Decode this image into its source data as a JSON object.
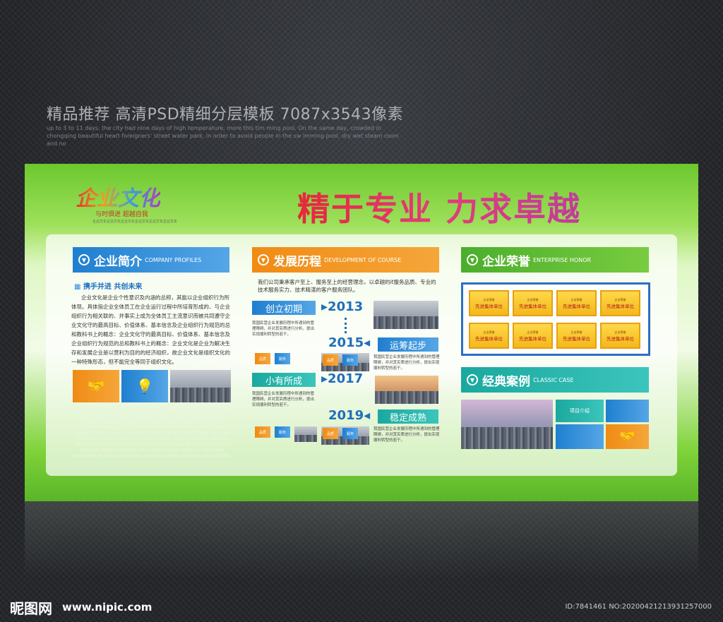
{
  "page": {
    "title": "精品推荐 高清PSD精细分层模板 7087x3543像素",
    "desc": "up to 3 to 11 days, the city had nine days of high temperature, more this tim ming pool. On the same day, crowded in chongqing beautiful heart foreigners' street water park, in order to avoid people in the sw imming pool, dry wet steam room and no"
  },
  "board": {
    "culture": "企业文化",
    "culture_sub": "与时俱进 超越自我",
    "culture_tiny": "企业文化企业文化企业文化企业文化企业文化企业文化",
    "slogan": "精于专业 力求卓越"
  },
  "profile": {
    "title": "企业简介",
    "en": "COMPANY PROFILES",
    "sub": "携手并进 共创未来",
    "text": "企业文化是企业个性意识及内涵的总称，其能以企业组织行为所体现。具体指企业全体员工在企业运行过程中所培育形成的、与企业组织行为相关联的、并事实上成为全体员工主流意识而被共同遵守企业文化守的最高目标、价值体系、基本信念及企业组织行为规范的总和教科书上的概念：企业文化守的最高目标、价值体系、基本信念及企业组织行为规范的总和教科书上的概念：企业文化是企业为解决生存和发展企业是以营利为目的的经济组织，故企业文化是组织文化的一种特殊形态，但不能完全等同于组织文化。",
    "en_text": "The enterprise culture is the enterprise individual consciousness and connota-tion, its can with the floorboard of enterprise organization behavior embodied. Specific means enterprise staff in enterprise operation process of the cultivation of the formation, and business organization behavior associated, and in fact be the staff was common mainstream awareness as enterprise culture, keep the highest objective value system, was common mainstream awareness as enterprise culture, keep the highest objective value system, was common mainstream awareness as enterprise culture, keep the highest objective value system."
  },
  "history": {
    "title": "发展历程",
    "en": "DEVELOPMENT OF COURSE",
    "intro": "我们公司秉承客户至上、服务至上的经营理念，以卓越的it服务品质、专业的技术服务实力、技术精湛的客户服务团队。",
    "stages": [
      {
        "label": "创立初期",
        "year": "2013"
      },
      {
        "label": "运筹起步",
        "year": "2015"
      },
      {
        "label": "小有所成",
        "year": "2017"
      },
      {
        "label": "稳定成熟",
        "year": "2019"
      }
    ],
    "small": "我国民营企业发展历程中所遇到的管理障碍，并对其实质进行分析，提出实现顺利转型的若干。",
    "mini1": "品质",
    "mini2": "服务"
  },
  "honor": {
    "title": "企业荣誉",
    "en": "ENTERPRISE HONOR",
    "cert_title": "企业荣誉",
    "cert_name": "先进集体单位"
  },
  "cases": {
    "title": "经典案例",
    "en": "CLASSIC CASE",
    "tile_label": "项目介绍"
  },
  "footer": {
    "logo": "昵图网",
    "url": "www.nipic.com",
    "id": "ID:7841461 NO:20200421213931257000"
  }
}
